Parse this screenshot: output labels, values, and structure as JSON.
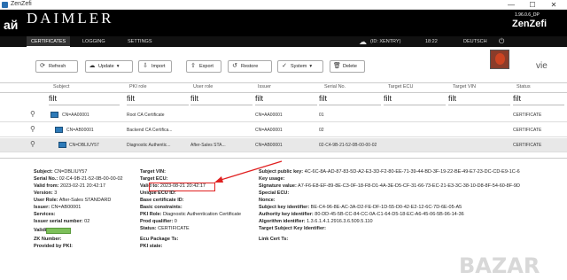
{
  "window": {
    "title": "ZenZefi",
    "min": "—",
    "max": "☐",
    "close": "✕"
  },
  "header": {
    "brand": "DAIMLER",
    "version": "1.96.0.6_DP",
    "product": "ZenZefi",
    "watermark_left": "ай"
  },
  "nav": {
    "tabs": [
      "CERTIFICATES",
      "LOGGING",
      "SETTINGS"
    ],
    "user": "(ID: XENTRY)",
    "time": "18:22",
    "language": "DEUTSCH"
  },
  "toolbar": {
    "refresh": "Refresh",
    "update": "Update",
    "import": "Import",
    "export": "Export",
    "restore": "Restore",
    "system": "System",
    "delete": "Delete",
    "vie": "vie"
  },
  "table": {
    "headers": [
      "Subject",
      "PKI role",
      "User role",
      "Issuer",
      "Serial No.",
      "Target ECU",
      "Target VIN",
      "Status"
    ],
    "filter": "filt",
    "rows": [
      {
        "subject": "CN=AA00001",
        "pki_role": "Root CA Certificate",
        "user_role": "",
        "issuer": "CN=AA00001",
        "serial": "01",
        "status": "CERTIFICATE"
      },
      {
        "subject": "CN=AB00001",
        "pki_role": "Backend CA Certifica...",
        "user_role": "",
        "issuer": "CN=AA00001",
        "serial": "02",
        "status": "CERTIFICATE"
      },
      {
        "subject": "CN=DBLIUY57",
        "pki_role": "Diagnostic Authentic...",
        "user_role": "After-Sales STA...",
        "issuer": "CN=AB00001",
        "serial": "02-C4-9B-21-52-0B-00-00-02",
        "status": "CERTIFICATE"
      }
    ]
  },
  "details": {
    "col1": [
      {
        "label": "Subject:",
        "value": " CN=DBLIUY57"
      },
      {
        "label": "Serial No.:",
        "value": " 02-C4-9B-21-52-0B-00-00-02"
      },
      {
        "label": "Valid from:",
        "value": " 2023-02-21 20:42:17"
      },
      {
        "label": "Version:",
        "value": " 3"
      },
      {
        "label": "User Role:",
        "value": " After-Sales STANDARD"
      },
      {
        "label": "Issuer:",
        "value": " CN=AB00001"
      },
      {
        "label": "Services:",
        "value": ""
      },
      {
        "label": "Issuer serial number:",
        "value": " 02"
      },
      {
        "label": "Validity:",
        "value": ""
      },
      {
        "label": "ZK Number:",
        "value": ""
      },
      {
        "label": "Provided by PKI:",
        "value": ""
      }
    ],
    "col2": [
      {
        "label": "Target VIN:",
        "value": ""
      },
      {
        "label": "Target ECU:",
        "value": ""
      },
      {
        "label": "Valid to:",
        "value": " 2023-08-21 20:42:17"
      },
      {
        "label": "Unique ECU ID:",
        "value": ""
      },
      {
        "label": "Base certificate ID:",
        "value": ""
      },
      {
        "label": "Basic constraints:",
        "value": ""
      },
      {
        "label": "PKI Role:",
        "value": " Diagnostic Authentication Certificate"
      },
      {
        "label": "Prod qualifier:",
        "value": " 0"
      },
      {
        "label": "Status:",
        "value": " CERTIFICATE"
      },
      {
        "label": "Ecu Package Ts:",
        "value": ""
      },
      {
        "label": "PKI state:",
        "value": ""
      }
    ],
    "col3": [
      {
        "label": "Subject public key:",
        "value": " 4C-6C-8A-AD-87-83-5D-A2-E3-3D-F2-80-EE-71-39-44-BD-3F-19-22-BE-49-E7-23-DC-CD-E9-1C-6"
      },
      {
        "label": "Key usage:",
        "value": ""
      },
      {
        "label": "Signature value:",
        "value": " A7-F6-E8-EF-89-8E-C3-0F-18-F8-D1-4A-3E-D5-CF-31-66-73-EC-21-E3-3C-38-10-D8-8F-54-60-8F-9D"
      },
      {
        "label": "Special ECU:",
        "value": ""
      },
      {
        "label": "Nonce:",
        "value": ""
      },
      {
        "label": "Subject key identifier:",
        "value": " BE-C4-96-8E-AC-3A-D2-FE-DF-1D-55-D0-42-E2-12-6C-7D-6E-05-A5"
      },
      {
        "label": "Authority key identifier:",
        "value": " 80-DD-45-5B-CC-84-CC-0A-C1-64-D5-18-EC-A6-45-06-5B-96-14-36"
      },
      {
        "label": "Algorithm identifier:",
        "value": " 1.3.6.1.4.1.2916.3.6.509.5.110"
      },
      {
        "label": "Target Subject Key Identifier:",
        "value": ""
      },
      {
        "label": "Link Cert Ts:",
        "value": ""
      }
    ],
    "watermark": "BAZAR"
  },
  "colors": {
    "header_bg": "#000000",
    "highlight": "#e02020",
    "validity": "#7dbf5a"
  }
}
